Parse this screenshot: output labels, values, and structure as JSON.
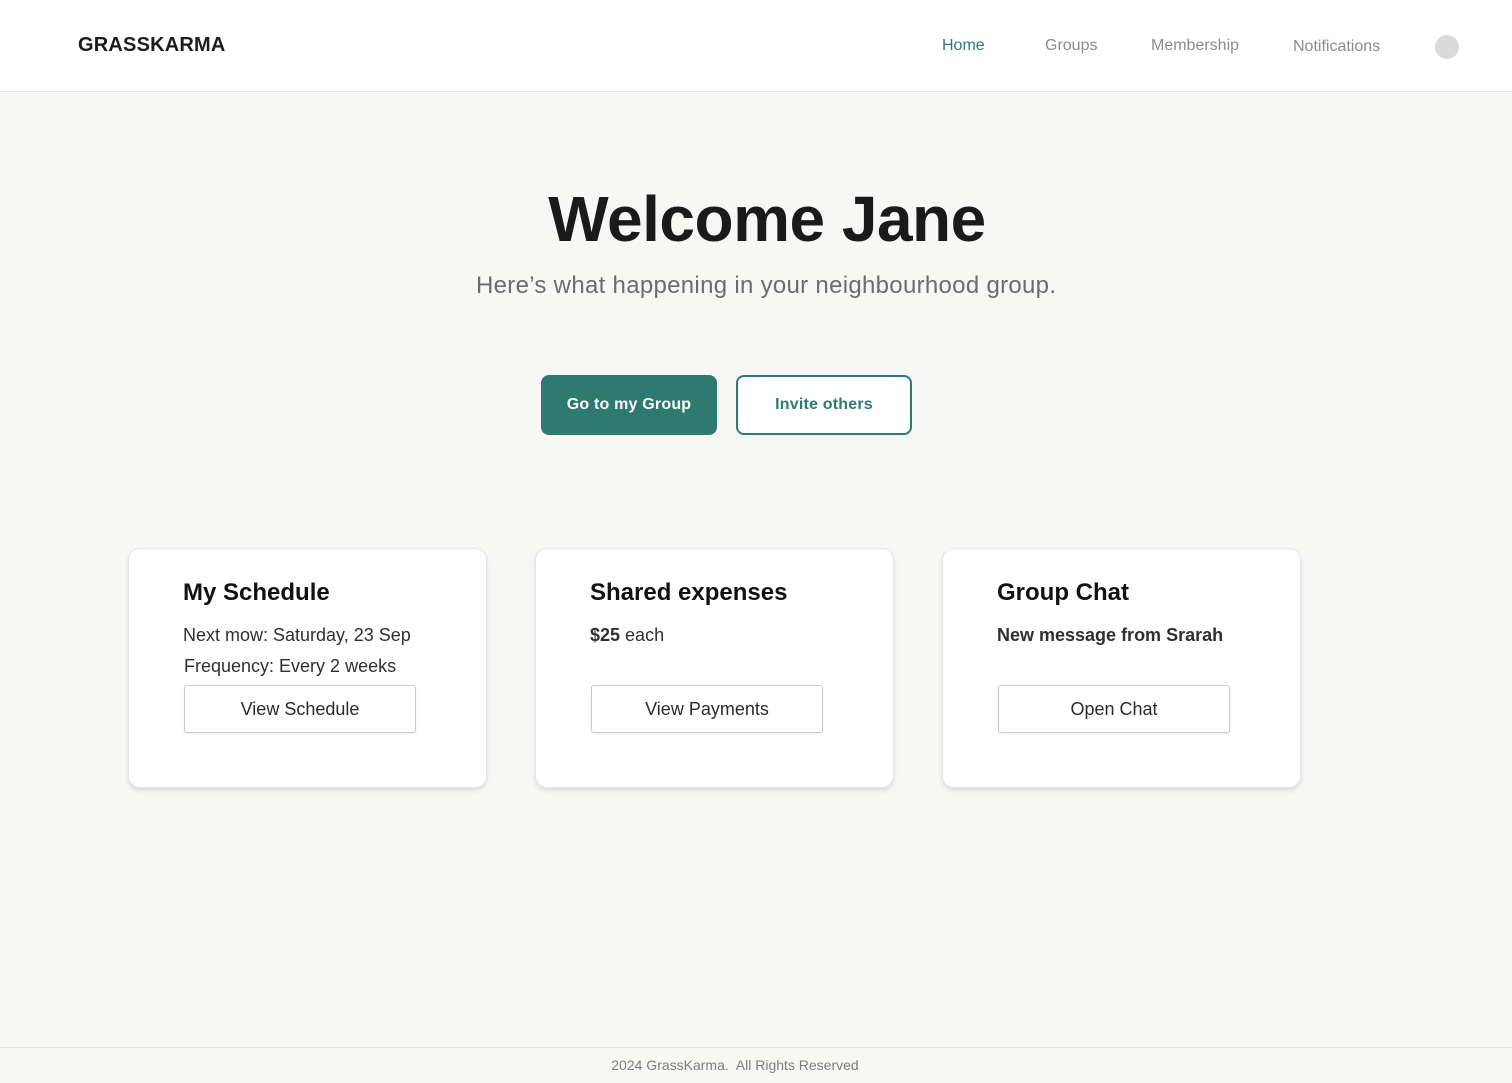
{
  "header": {
    "logo": "GRASSKARMA",
    "nav": {
      "home": "Home",
      "groups": "Groups",
      "membership": "Membership",
      "notifications": "Notifications"
    },
    "active_tab": "Home"
  },
  "hero": {
    "title": "Welcome Jane",
    "subtitle": "Here’s what happening in your neighbourhood group.",
    "primary_button": "Go to my Group",
    "secondary_button": "Invite others"
  },
  "cards": {
    "schedule": {
      "title": "My Schedule",
      "next_mow": "Next mow: Saturday, 23 Sep",
      "frequency": "Frequency: Every 2 weeks",
      "button": "View Schedule"
    },
    "expenses": {
      "title": "Shared expenses",
      "amount": "$25",
      "amount_suffix": " each",
      "button": "View Payments"
    },
    "chat": {
      "title": "Group Chat",
      "message": "New message from Srarah",
      "button": "Open Chat"
    }
  },
  "footer": {
    "text": "2024 GrassKarma.  All Rights Reserved"
  },
  "colors": {
    "accent": "#2e7a70",
    "background": "#f7f8f6",
    "card": "#ffffff",
    "nav_inactive": "#8a8d8b"
  }
}
